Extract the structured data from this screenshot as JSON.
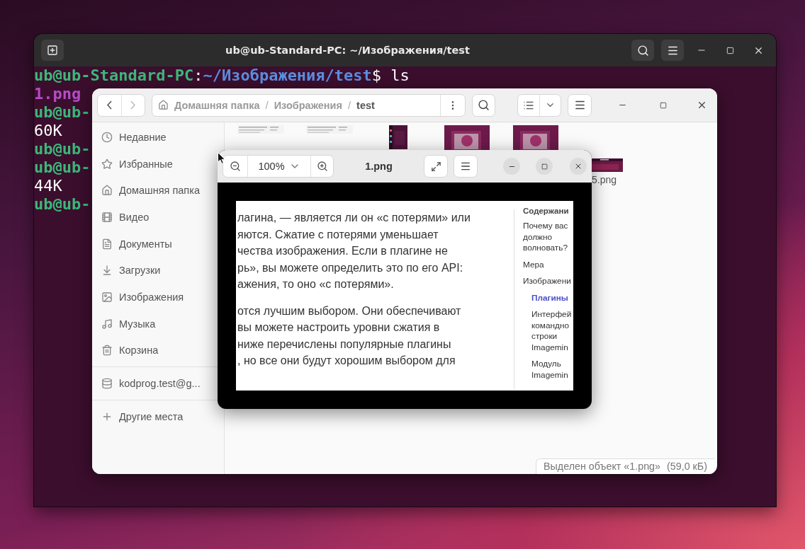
{
  "terminal": {
    "title": "ub@ub-Standard-PC: ~/Изображения/test",
    "lines": [
      [
        {
          "kind": "prompt",
          "text": "ub@ub-Standard-PC"
        },
        {
          "kind": "plain",
          "text": ":"
        },
        {
          "kind": "path",
          "text": "~/Изображения/test"
        },
        {
          "kind": "plain",
          "text": "$ ls"
        }
      ],
      [
        {
          "kind": "file",
          "text": "1.png"
        }
      ],
      [
        {
          "kind": "prompt",
          "text": "ub@ub-"
        }
      ],
      [
        {
          "kind": "plain",
          "text": "60K"
        }
      ],
      [
        {
          "kind": "prompt",
          "text": "ub@ub-"
        }
      ],
      [
        {
          "kind": "prompt",
          "text": "ub@ub-"
        }
      ],
      [
        {
          "kind": "plain",
          "text": "44K"
        }
      ],
      [
        {
          "kind": "prompt",
          "text": "ub@ub-"
        }
      ]
    ]
  },
  "files": {
    "path": {
      "separator": "/",
      "crumbs": [
        {
          "label": "Домашняя папка",
          "current": false
        },
        {
          "label": "Изображения",
          "current": false
        },
        {
          "label": "test",
          "current": true
        }
      ]
    },
    "sidebar": {
      "places": [
        "Недавние",
        "Избранные",
        "Домашняя папка",
        "Видео",
        "Документы",
        "Загрузки",
        "Изображения",
        "Музыка",
        "Корзина"
      ],
      "mounts": [
        "kodprog.test@g..."
      ],
      "other": [
        "Другие места"
      ]
    },
    "items": [
      {
        "kind": "document"
      },
      {
        "kind": "document"
      },
      {
        "kind": "tall"
      },
      {
        "kind": "screen"
      },
      {
        "kind": "screen"
      },
      {
        "kind": "wide",
        "name": "5.png"
      }
    ],
    "status": {
      "selection": "Выделен объект «1.png»",
      "size": "(59,0 кБ)"
    }
  },
  "viewer": {
    "title": "1.png",
    "zoom": "100%",
    "paragraphs": [
      [
        "лагина, — является ли он «с потерями» или",
        "яются. Сжатие с потерями уменьшает",
        "чества изображения. Если в плагине не",
        "рь», вы можете определить это по его API:",
        "ажения, то оно «с потерями»."
      ],
      [
        "отся лучшим выбором. Они обеспечивают",
        "вы можете настроить уровни сжатия в",
        "ниже перечислены популярные плагины",
        ", но все они будут хорошим выбором для"
      ]
    ],
    "toc": {
      "title": "Содержани",
      "items": [
        {
          "lines": [
            "Почему вас",
            "должно",
            "волновать?"
          ],
          "selected": false
        },
        {
          "lines": [
            "Мера"
          ],
          "selected": false
        },
        {
          "lines": [
            "Изображени"
          ],
          "selected": false,
          "children": [
            {
              "lines": [
                "Плагины"
              ],
              "selected": true
            },
            {
              "lines": [
                "Интерфей",
                "командно",
                "строки",
                "Imagemin"
              ],
              "selected": false
            },
            {
              "lines": [
                "Модуль",
                "Imagemin"
              ],
              "selected": false
            }
          ]
        }
      ]
    }
  }
}
